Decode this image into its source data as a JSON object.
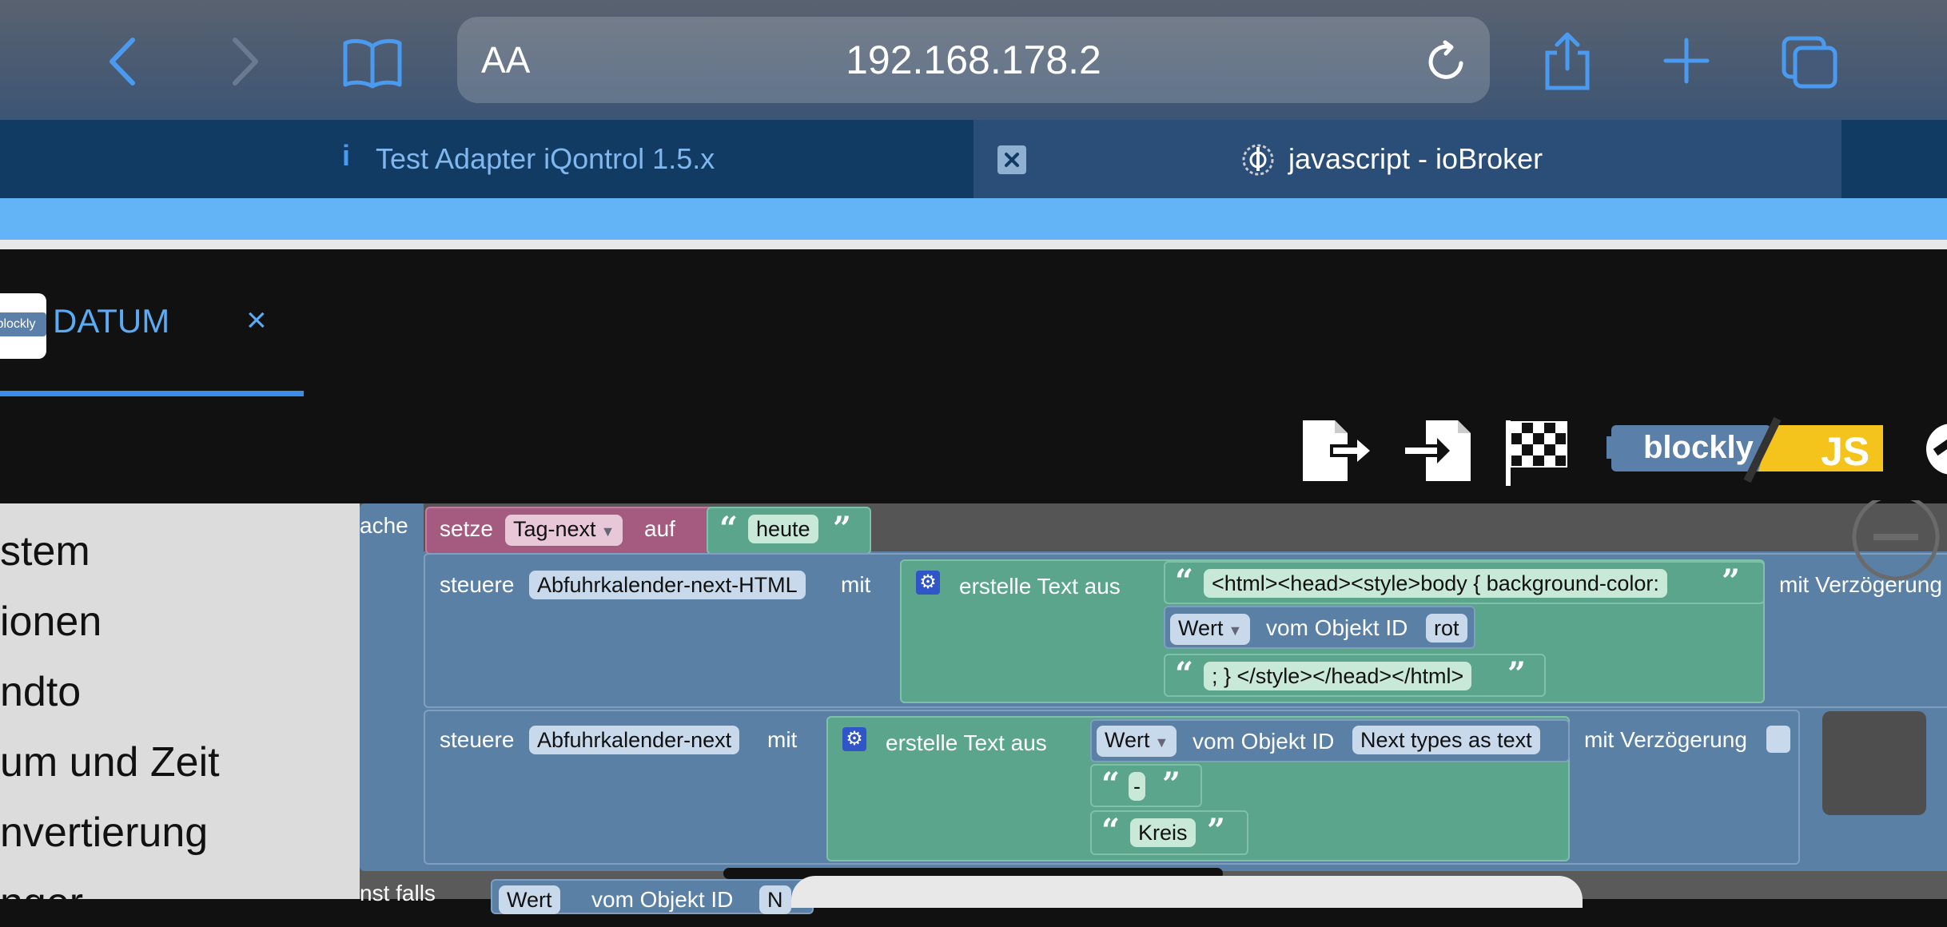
{
  "browser": {
    "url": "192.168.178.2",
    "text_size_label": "AA",
    "tabs": [
      {
        "label": "Test Adapter iQontrol 1.5.x",
        "icon_text": "i"
      },
      {
        "label": "javascript - ioBroker"
      }
    ]
  },
  "editor_tab": {
    "label": "DATUM",
    "logo_text": "blockly",
    "close_label": "×"
  },
  "toolbar": {
    "blockly_label": "blockly",
    "js_label": "JS"
  },
  "sidebar": {
    "items": [
      "stem",
      "ionen",
      "ndto",
      "um und Zeit",
      "nvertierung",
      "nger"
    ]
  },
  "workspace": {
    "side_labels": [
      "ache",
      "nst falls"
    ],
    "set_block": {
      "keyword": "setze",
      "variable": "Tag-next",
      "auf": "auf",
      "value": "heute"
    },
    "control1": {
      "keyword": "steuere",
      "target": "Abfuhrkalender-next-HTML",
      "mit": "mit",
      "create_text": "erstelle Text aus",
      "string1": "<html><head><style>body { background-color:",
      "value_label": "Wert",
      "object_label": "vom Objekt ID",
      "object_value": "rot",
      "string2": "; } </style></head></html>",
      "delay": "mit Verzögerung"
    },
    "control2": {
      "keyword": "steuere",
      "target": "Abfuhrkalender-next",
      "mit": "mit",
      "create_text": "erstelle Text aus",
      "value_label": "Wert",
      "object_label": "vom Objekt ID",
      "object_value": "Next types as text",
      "dash": "-",
      "circle": "Kreis",
      "delay": "mit Verzögerung"
    },
    "bottom_partial": {
      "value_label": "Wert",
      "object_label": "vom Objekt ID",
      "object_value": "N"
    }
  },
  "icons": [
    "back-icon",
    "forward-icon",
    "bookmarks-icon",
    "reload-icon",
    "share-icon",
    "new-tab-icon",
    "tabs-icon",
    "export-icon",
    "import-icon",
    "run-flag-icon",
    "minus-zoom-icon"
  ]
}
